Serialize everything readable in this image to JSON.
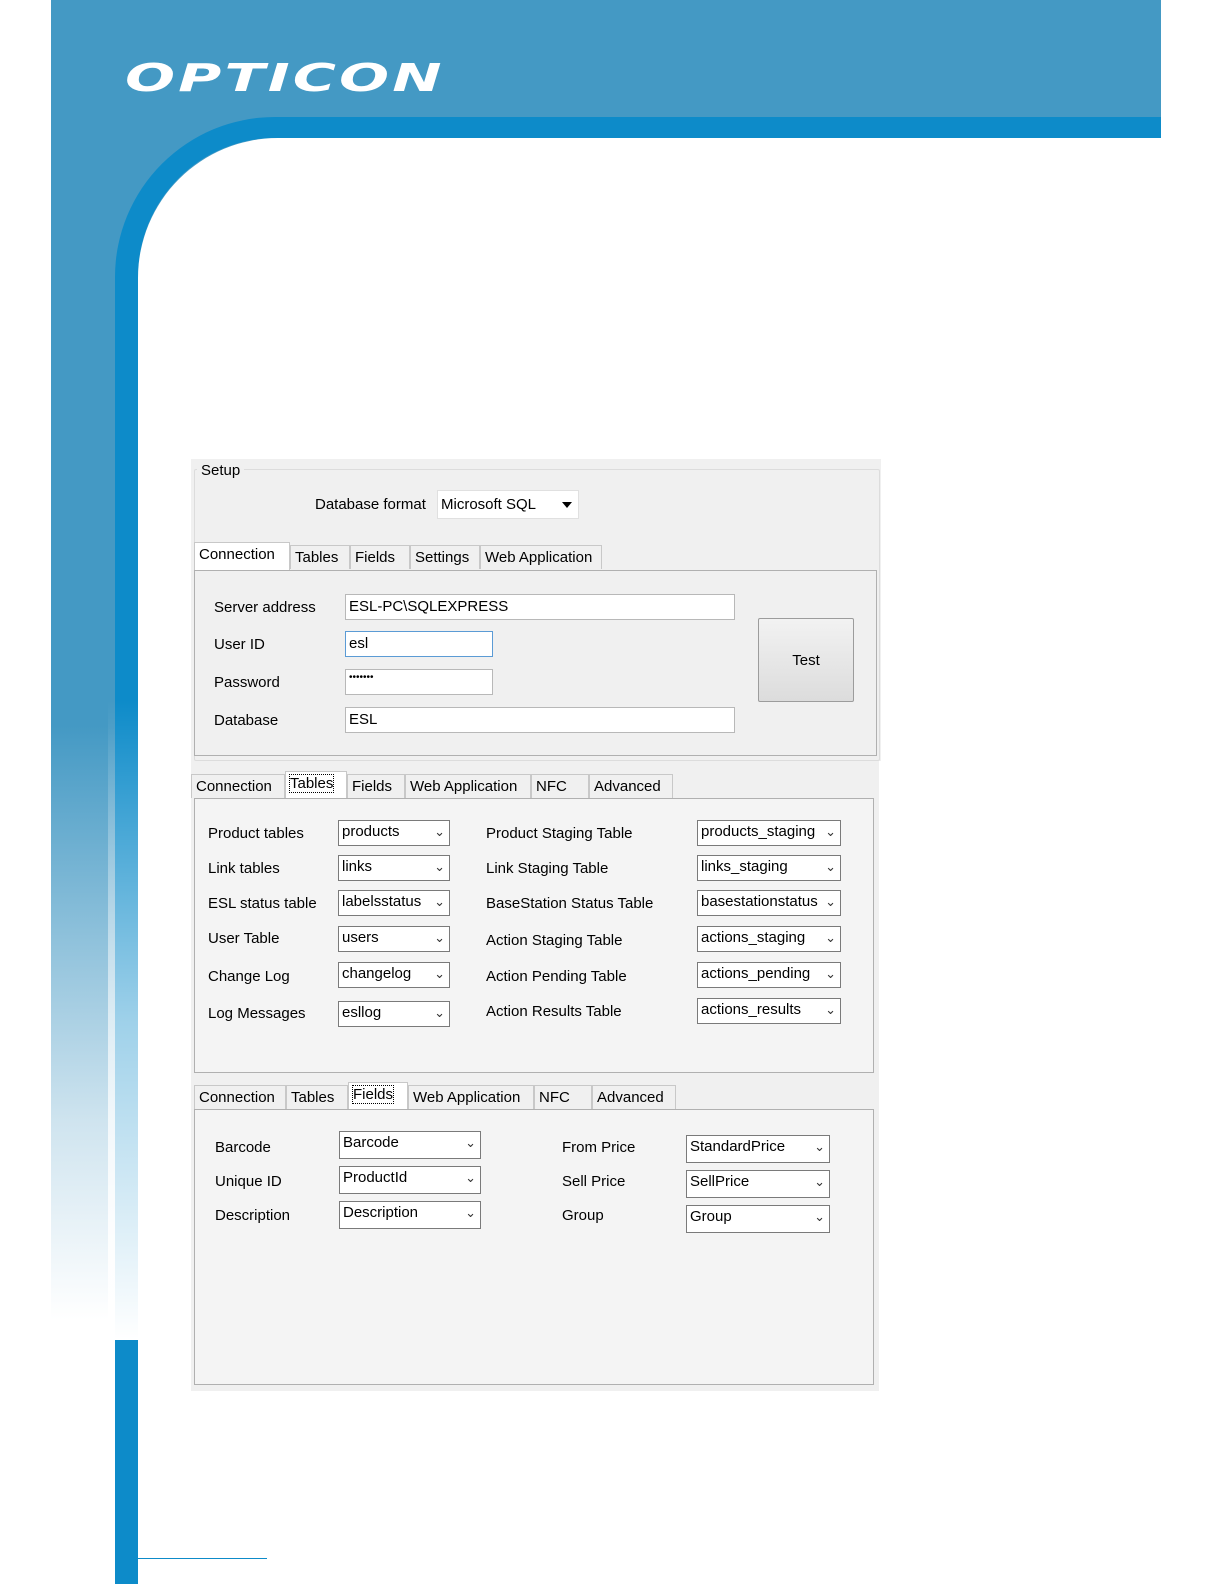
{
  "brand": {
    "logo_text": "OPTICON"
  },
  "setup": {
    "group_title": "Setup",
    "database_format_label": "Database format",
    "database_format_value": "Microsoft SQL",
    "tabs": [
      "Connection",
      "Tables",
      "Fields",
      "Settings",
      "Web Application"
    ],
    "connection": {
      "server_address_label": "Server address",
      "server_address_value": "ESL-PC\\SQLEXPRESS",
      "user_id_label": "User ID",
      "user_id_value": "esl",
      "password_label": "Password",
      "password_value": "•••••••",
      "database_label": "Database",
      "database_value": "ESL",
      "test_button": "Test"
    }
  },
  "tables_panel": {
    "tabs": [
      "Connection",
      "Tables",
      "Fields",
      "Web Application",
      "NFC",
      "Advanced"
    ],
    "left": [
      {
        "label": "Product tables",
        "value": "products"
      },
      {
        "label": "Link tables",
        "value": "links"
      },
      {
        "label": "ESL status table",
        "value": "labelsstatus"
      },
      {
        "label": "User Table",
        "value": "users"
      },
      {
        "label": "Change Log",
        "value": "changelog"
      },
      {
        "label": "Log Messages",
        "value": "esllog"
      }
    ],
    "right": [
      {
        "label": "Product Staging Table",
        "value": "products_staging"
      },
      {
        "label": "Link Staging Table",
        "value": "links_staging"
      },
      {
        "label": "BaseStation Status Table",
        "value": "basestationstatus"
      },
      {
        "label": "Action Staging Table",
        "value": "actions_staging"
      },
      {
        "label": "Action Pending Table",
        "value": "actions_pending"
      },
      {
        "label": "Action Results Table",
        "value": "actions_results"
      }
    ]
  },
  "fields_panel": {
    "tabs": [
      "Connection",
      "Tables",
      "Fields",
      "Web Application",
      "NFC",
      "Advanced"
    ],
    "left": [
      {
        "label": "Barcode",
        "value": "Barcode"
      },
      {
        "label": "Unique ID",
        "value": "ProductId"
      },
      {
        "label": "Description",
        "value": "Description"
      }
    ],
    "right": [
      {
        "label": "From Price",
        "value": "StandardPrice"
      },
      {
        "label": "Sell Price",
        "value": "SellPrice"
      },
      {
        "label": "Group",
        "value": "Group"
      }
    ]
  },
  "icons": {
    "dropdown": "chevron-down-icon",
    "dropdown_solid": "caret-down-icon"
  }
}
